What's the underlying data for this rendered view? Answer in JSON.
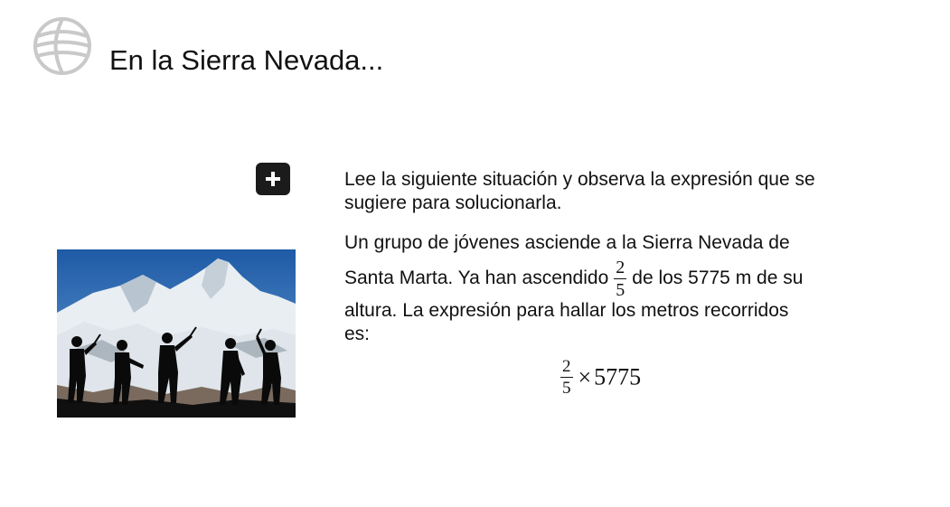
{
  "header": {
    "title": "En la Sierra Nevada..."
  },
  "content": {
    "intro": "Lee la siguiente situación y observa la expresión que se sugiere para solucionarla.",
    "problem": {
      "line1": "Un grupo de jóvenes asciende a la Sierra Nevada de",
      "line2_before": "Santa Marta. Ya han ascendido",
      "fraction": {
        "numerator": "2",
        "denominator": "5"
      },
      "line2_after": "de los 5775 m de su",
      "line3": "altura. La expresión para hallar los metros recorridos",
      "line4": "es:"
    },
    "formula": {
      "fraction": {
        "numerator": "2",
        "denominator": "5"
      },
      "operator": "×",
      "number": "5775"
    }
  },
  "icons": {
    "logo": "globe-logo-icon",
    "expand": "plus-icon"
  },
  "colors": {
    "button_bg": "#1b1b1b",
    "logo_gray": "#c9c9c9",
    "text": "#111111"
  }
}
